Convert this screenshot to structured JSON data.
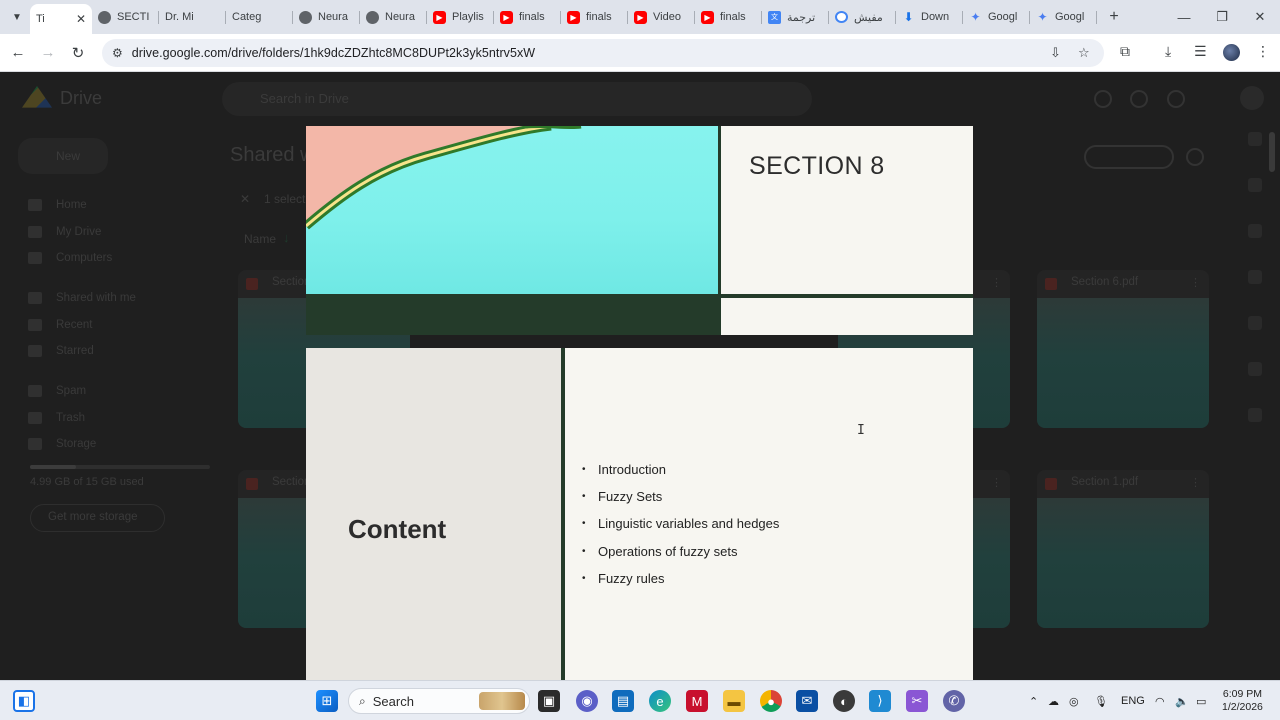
{
  "browser": {
    "tabs": [
      {
        "label": "Ti",
        "favicon": "drive-icon",
        "active": true
      },
      {
        "label": "SECTI",
        "favicon": "globe-icon"
      },
      {
        "label": "Dr. Mi",
        "favicon": "drive-icon"
      },
      {
        "label": "Categ",
        "favicon": "drive-icon"
      },
      {
        "label": "Neura",
        "favicon": "globe-icon"
      },
      {
        "label": "Neura",
        "favicon": "globe-icon"
      },
      {
        "label": "Playlis",
        "favicon": "youtube-icon"
      },
      {
        "label": "finals",
        "favicon": "youtube-icon"
      },
      {
        "label": "finals",
        "favicon": "youtube-icon"
      },
      {
        "label": "Video",
        "favicon": "youtube-icon"
      },
      {
        "label": "finals",
        "favicon": "youtube-icon"
      },
      {
        "label": "ترجمة",
        "favicon": "translate-icon"
      },
      {
        "label": "مفيش",
        "favicon": "google-icon"
      },
      {
        "label": "Down",
        "favicon": "download-icon"
      },
      {
        "label": "Googl",
        "favicon": "gemini-icon"
      },
      {
        "label": "Googl",
        "favicon": "gemini-icon"
      }
    ],
    "url": "drive.google.com/drive/folders/1hk9dcZDZhtc8MC8DUPt2k3yk5ntrv5xW"
  },
  "drive_background": {
    "app_name": "Drive",
    "search_placeholder": "Search in Drive",
    "new_label": "New",
    "nav": [
      "Home",
      "My Drive",
      "Computers",
      "Shared with me",
      "Recent",
      "Starred",
      "Spam",
      "Trash",
      "Storage"
    ],
    "storage_text": "4.99 GB of 15 GB used",
    "get_storage": "Get more storage",
    "page_title": "Shared w",
    "selection": "1 select",
    "sort_label": "Name",
    "files": [
      "Section",
      "Section 6.pdf",
      "Section",
      "Section 1.pdf"
    ]
  },
  "slide": {
    "title": "SECTION 8",
    "heading": "Content",
    "bullets": [
      "Introduction",
      "Fuzzy Sets",
      "Linguistic variables and hedges",
      "Operations of fuzzy sets",
      "Fuzzy rules"
    ],
    "colors": {
      "accent_dark_green": "#243b2a",
      "panel": "#f7f6f1",
      "aqua": "#80f1ec"
    }
  },
  "taskbar": {
    "search_label": "Search",
    "language": "ENG",
    "time": "6:09 PM",
    "date": "1/2/2026"
  }
}
